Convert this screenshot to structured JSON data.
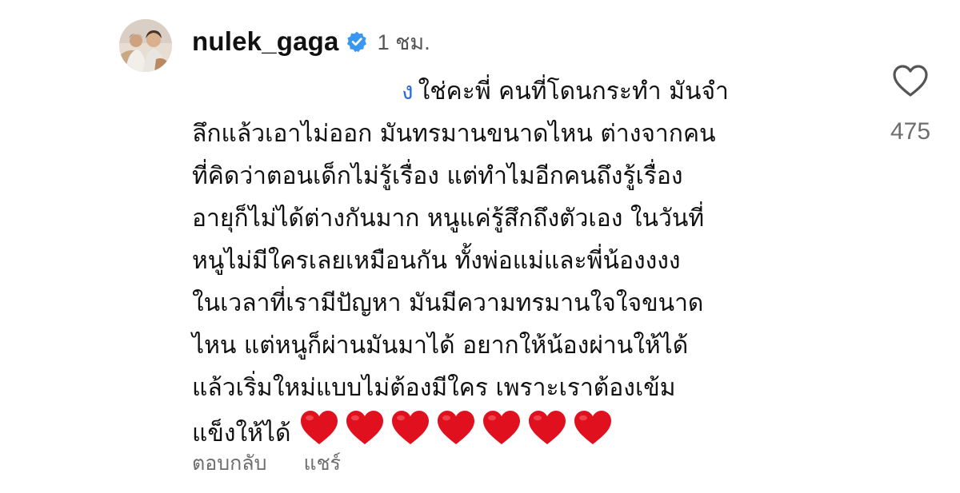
{
  "comment": {
    "username": "nulek_gaga",
    "verified_icon": "verified-badge-icon",
    "timestamp": "1 ชม.",
    "mention_mark": "ง",
    "lines": [
      "ใช่คะพี่ คนที่โดนกระทำ มันจำ",
      "ลึกแล้วเอาไม่ออก มันทรมานขนาดไหน ต่างจากคน",
      "ที่คิดว่าตอนเด็กไม่รู้เรื่อง แต่ทำไมอีกคนถึงรู้เรื่อง",
      "อายุก็ไม่ได้ต่างกันมาก หนูแค่รู้สึกถึงตัวเอง ในวันที่",
      "หนูไม่มีใครเลยเหมือนกัน  ทั้งพ่อแม่และพี่น้องงงง",
      "ในเวลาที่เรามีปัญหา มันมีความทรมานใจใจขนาด",
      "ไหน  แต่หนูก็ผ่านมันมาได้  อยากให้น้องผ่านให้ได้",
      "แล้วเริ่มใหม่แบบไม่ต้องมีใคร  เพราะเราต้องเข้ม",
      "แข็งให้ได้"
    ],
    "heart_emoji_count": 7,
    "heart_emoji": "red-heart-emoji",
    "like_icon": "heart-outline-icon",
    "like_count": "475",
    "reply_label": "ตอบกลับ",
    "share_label": "แชร์",
    "colors": {
      "verified": "#3897F0",
      "heart_emoji": "#E0101E",
      "muted_text": "#6E6E6E",
      "mention_mark": "#2F6BD6"
    }
  }
}
